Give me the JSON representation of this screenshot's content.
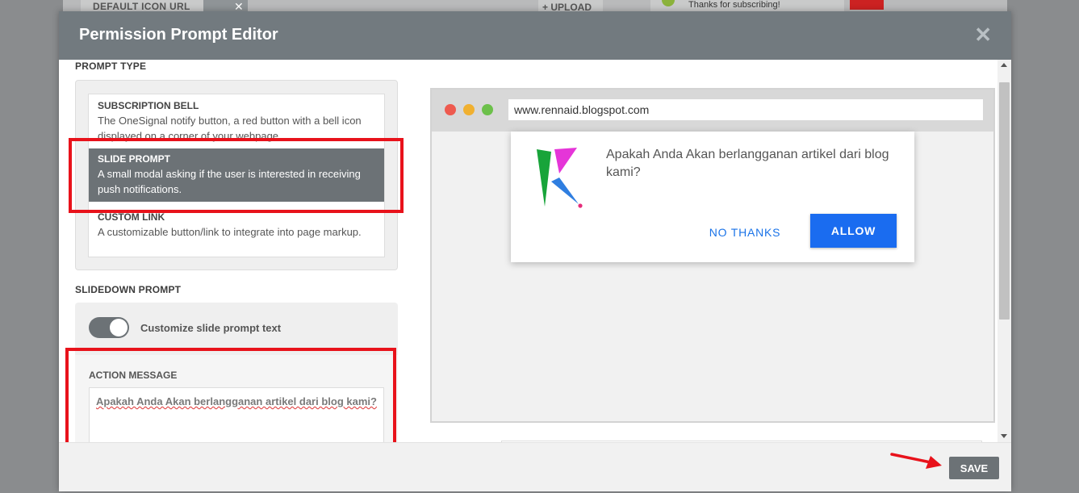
{
  "background": {
    "default_icon_label": "DEFAULT ICON URL",
    "upload_label": "UPLOAD",
    "thanks_text": "Thanks for subscribing!"
  },
  "modal": {
    "title": "Permission Prompt Editor",
    "close_glyph": "✕"
  },
  "prompt_type": {
    "label": "PROMPT TYPE",
    "options": [
      {
        "title": "SUBSCRIPTION BELL",
        "description": "The OneSignal notify button, a red button with a bell icon displayed on a corner of your webpage."
      },
      {
        "title": "SLIDE PROMPT",
        "description": "A small modal asking if the user is interested in receiving push notifications."
      },
      {
        "title": "CUSTOM LINK",
        "description": "A customizable button/link to integrate into page markup."
      }
    ],
    "selected": "SLIDE PROMPT"
  },
  "slidedown": {
    "label": "SLIDEDOWN PROMPT",
    "toggle_label": "Customize slide prompt text",
    "toggle_on": true,
    "action_message_label": "ACTION MESSAGE",
    "action_message_value": "Apakah Anda Akan berlangganan artikel dari blog kami?"
  },
  "preview": {
    "url": "www.rennaid.blogspot.com",
    "message": "Apakah Anda Akan berlangganan artikel dari blog kami?",
    "no_thanks_label": "NO THANKS",
    "allow_label": "ALLOW"
  },
  "footer": {
    "save_label": "SAVE"
  },
  "colors": {
    "header": "#727a7f",
    "selected": "#6c7276",
    "highlight": "#e8121b",
    "allow": "#1a6cf0",
    "traffic_red": "#ee5a4f",
    "traffic_yellow": "#f0b030",
    "traffic_green": "#6cc04a"
  },
  "icons": [
    "close-icon",
    "browser-close-dot",
    "browser-minimize-dot",
    "browser-maximize-dot",
    "site-logo-icon",
    "red-arrow-icon",
    "scroll-up-icon",
    "scroll-down-icon",
    "upload-plus-icon"
  ]
}
